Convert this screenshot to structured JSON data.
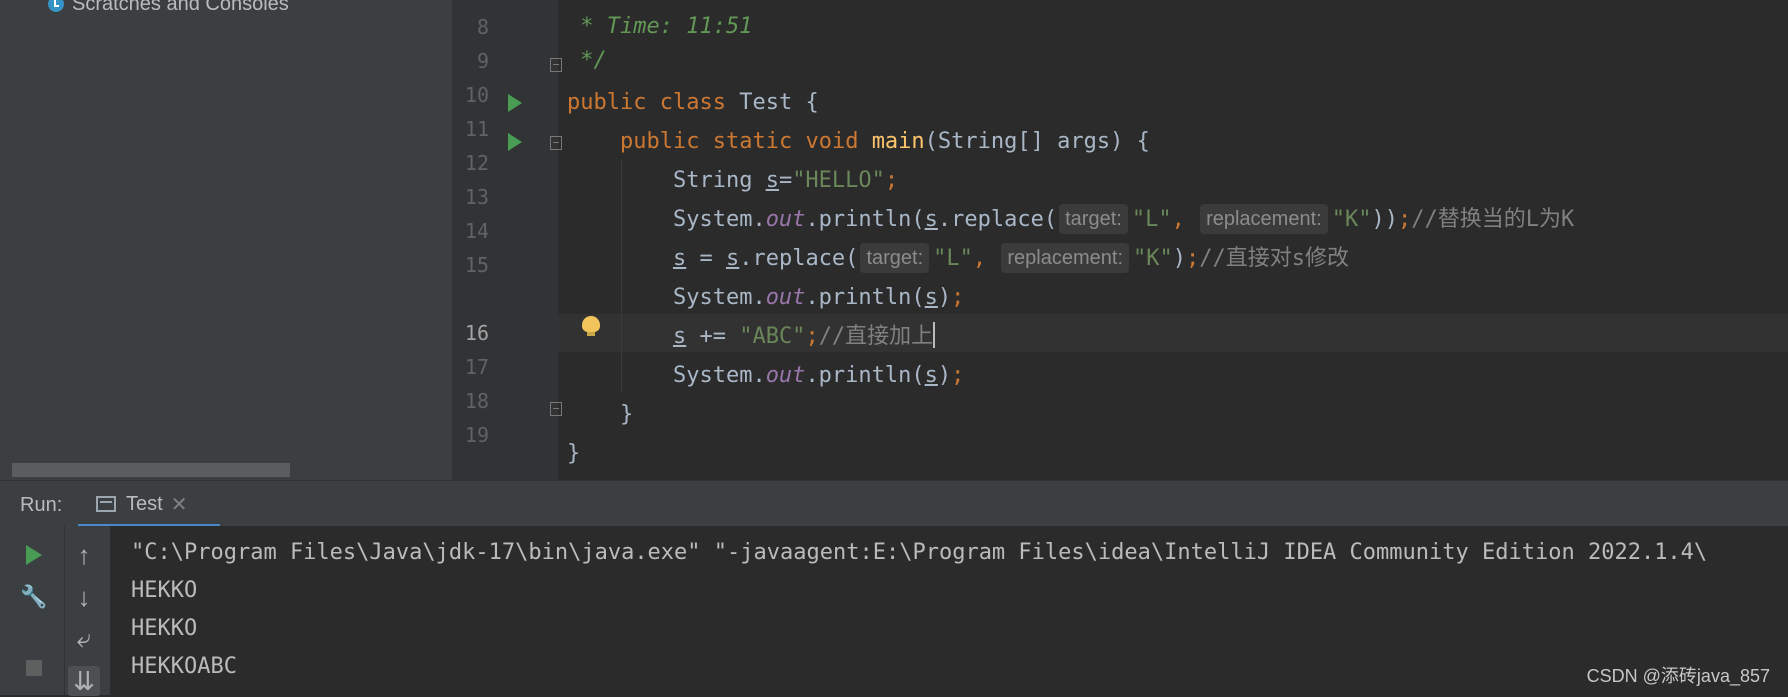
{
  "project": {
    "tree_item": "Scratches and Consoles"
  },
  "editor": {
    "current_line": 16,
    "line_numbers": [
      "8",
      "9",
      "10",
      "11",
      "12",
      "13",
      "14",
      "15",
      "16",
      "17",
      "18",
      "19"
    ],
    "code": {
      "l8": " * Time: 11:51",
      "l9": " */",
      "l10": {
        "kw1": "public",
        "kw2": "class",
        "name": "Test",
        "brace": " {"
      },
      "l11": {
        "kw1": "public",
        "kw2": "static",
        "kw3": "void",
        "fn": "main",
        "sig": "(String[] args) {"
      },
      "l12": {
        "type": "String ",
        "var": "s",
        "eq": "=",
        "str": "\"HELLO\"",
        "semi": ";"
      },
      "l13": {
        "sys": "System.",
        "field": "out",
        "call": ".println(",
        "var": "s",
        "call2": ".replace(",
        "hint1": "target:",
        "str1": "\"L\"",
        "comma": ",",
        "hint2": "replacement:",
        "str2": "\"K\"",
        "close": "))",
        "semi": ";",
        "comment": "//替换当的L为K"
      },
      "l14": {
        "var1": "s",
        "eq": " = ",
        "var2": "s",
        "call": ".replace(",
        "hint1": "target:",
        "str1": "\"L\"",
        "comma": ",",
        "hint2": "replacement:",
        "str2": "\"K\"",
        "close": ")",
        "semi": ";",
        "comment": "//直接对s修改"
      },
      "l15": {
        "sys": "System.",
        "field": "out",
        "call": ".println(",
        "var": "s",
        "close": ")",
        "semi": ";"
      },
      "l16": {
        "var": "s",
        "op": " += ",
        "str": "\"ABC\"",
        "semi": ";",
        "comment": "//直接加上"
      },
      "l17": {
        "sys": "System.",
        "field": "out",
        "call": ".println(",
        "var": "s",
        "close": ")",
        "semi": ";"
      },
      "l18": "}",
      "l19": "}"
    }
  },
  "run": {
    "label": "Run:",
    "tab": {
      "label": "Test",
      "close": "✕"
    },
    "toolbar": {
      "up": "↑",
      "down": "↓",
      "wrap": "⤶",
      "scroll": "⇊",
      "settings": "🔧"
    },
    "console": [
      "\"C:\\Program Files\\Java\\jdk-17\\bin\\java.exe\" \"-javaagent:E:\\Program Files\\idea\\IntelliJ IDEA Community Edition 2022.1.4\\",
      "HEKKO",
      "HEKKO",
      "HEKKOABC"
    ]
  },
  "watermark": "CSDN @添砖java_857",
  "colors": {
    "background": "#2b2b2b",
    "keyword": "#cc7832",
    "string": "#6a8759",
    "field": "#9876aa",
    "method": "#ffc66d",
    "run_green": "#499c54"
  },
  "icons": [
    "scratches-icon",
    "run-gutter-icon",
    "fold-icon",
    "bulb-icon",
    "run-icon",
    "stop-icon",
    "settings-icon",
    "up-arrow-icon",
    "down-arrow-icon",
    "soft-wrap-icon",
    "scroll-to-end-icon"
  ]
}
